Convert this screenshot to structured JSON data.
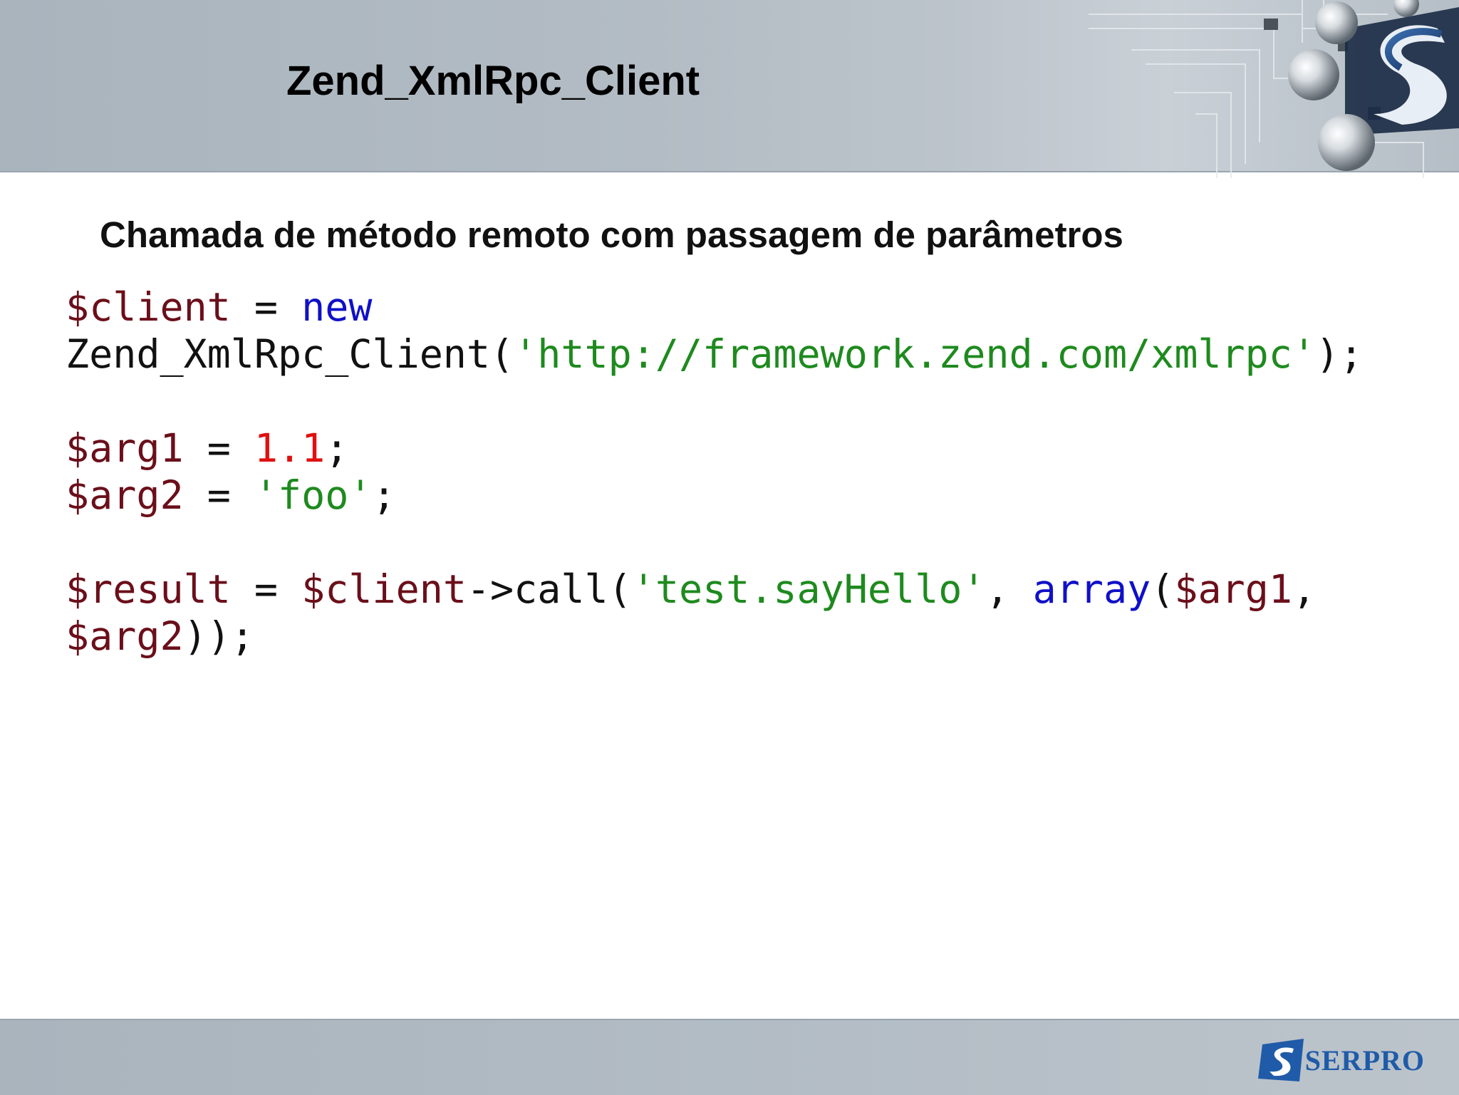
{
  "header": {
    "title": "Zend_XmlRpc_Client"
  },
  "content": {
    "subtitle": "Chamada de método remoto com passagem de parâmetros",
    "code_lines": [
      [
        {
          "t": "$client",
          "k": "var"
        },
        {
          "t": " = ",
          "k": "plain"
        },
        {
          "t": "new",
          "k": "kw"
        }
      ],
      [
        {
          "t": "Zend_XmlRpc_Client(",
          "k": "plain"
        },
        {
          "t": "'http://framework.zend.com/xmlrpc'",
          "k": "str"
        },
        {
          "t": ");",
          "k": "plain"
        }
      ],
      [],
      [
        {
          "t": "$arg1",
          "k": "var"
        },
        {
          "t": " = ",
          "k": "plain"
        },
        {
          "t": "1.1",
          "k": "num"
        },
        {
          "t": ";",
          "k": "plain"
        }
      ],
      [
        {
          "t": "$arg2",
          "k": "var"
        },
        {
          "t": " = ",
          "k": "plain"
        },
        {
          "t": "'foo'",
          "k": "str"
        },
        {
          "t": ";",
          "k": "plain"
        }
      ],
      [],
      [
        {
          "t": "$result",
          "k": "var"
        },
        {
          "t": " = ",
          "k": "plain"
        },
        {
          "t": "$client",
          "k": "var"
        },
        {
          "t": "->call(",
          "k": "plain"
        },
        {
          "t": "'test.sayHello'",
          "k": "str"
        },
        {
          "t": ", ",
          "k": "plain"
        },
        {
          "t": "array",
          "k": "kw"
        },
        {
          "t": "(",
          "k": "plain"
        },
        {
          "t": "$arg1",
          "k": "var"
        },
        {
          "t": ",",
          "k": "plain"
        }
      ],
      [
        {
          "t": "$arg2",
          "k": "var"
        },
        {
          "t": "));",
          "k": "plain"
        }
      ]
    ]
  },
  "footer": {
    "logo_text": "SERPRO",
    "logo_icon": "serpro-s-logo"
  },
  "colors": {
    "variable": "#6b0f1a",
    "keyword": "#1010c8",
    "string": "#1e8a1e",
    "number": "#e01010",
    "brand_blue": "#1f5ba8"
  }
}
